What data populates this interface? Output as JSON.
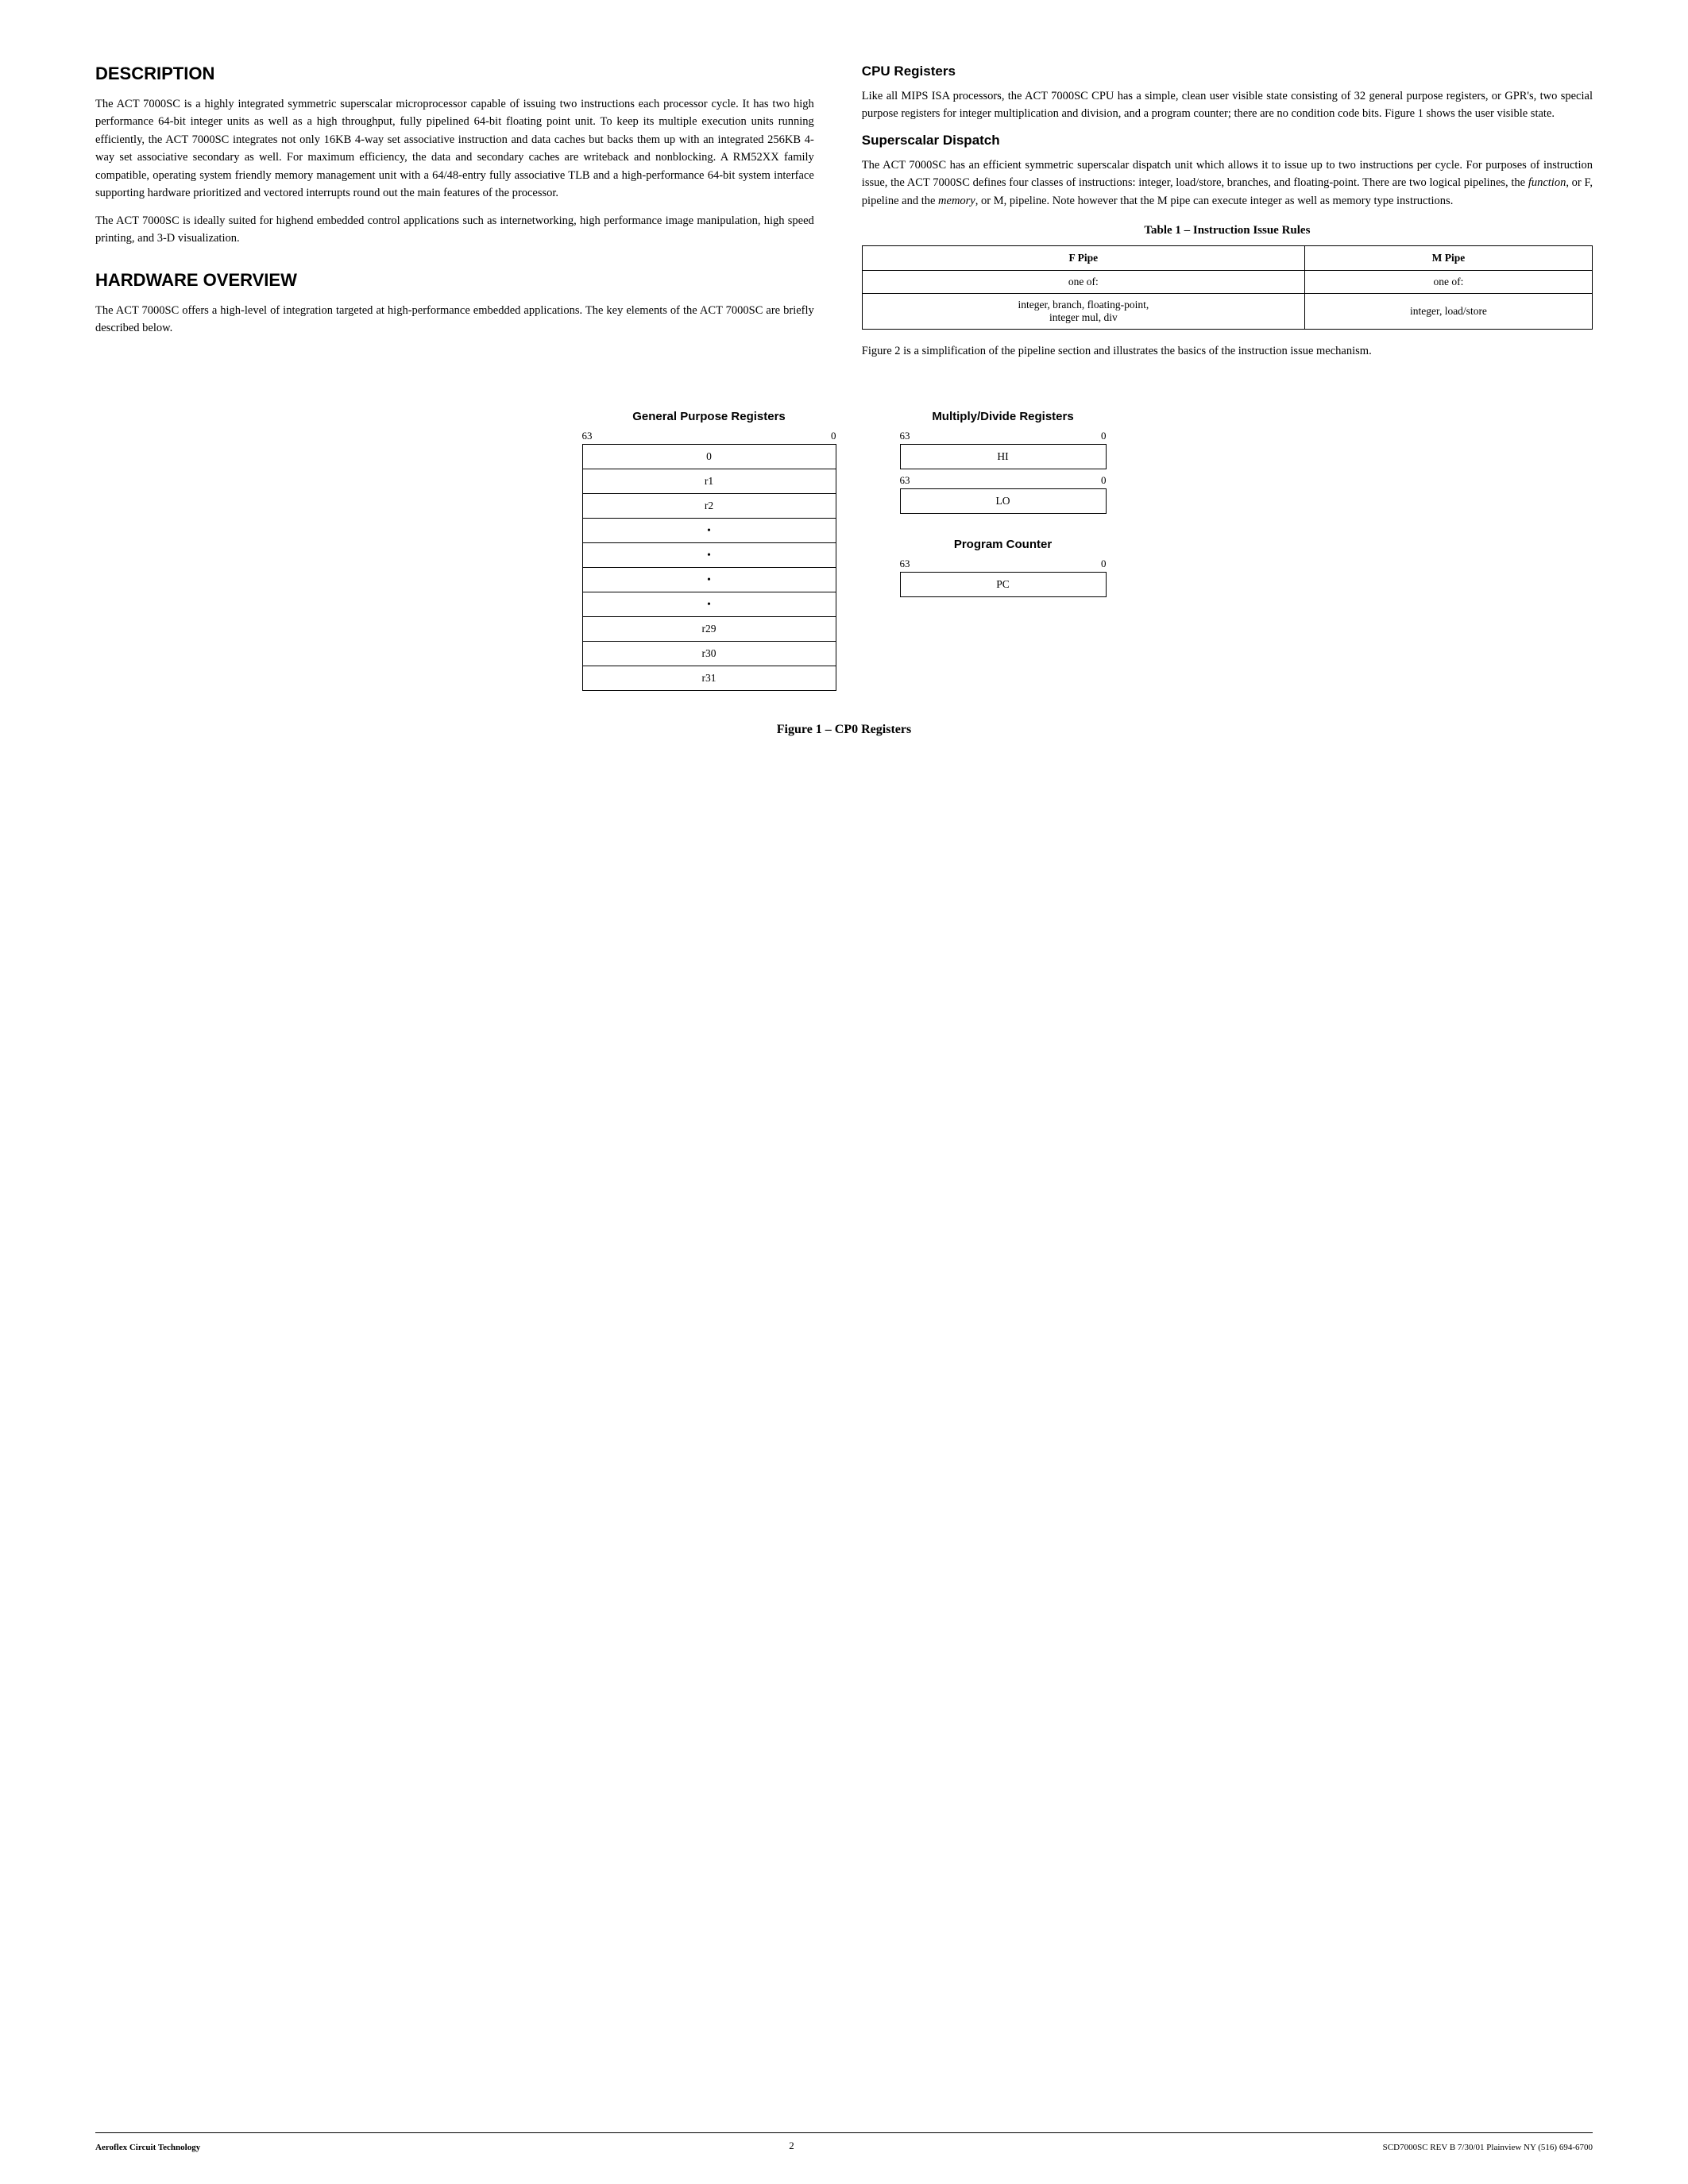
{
  "page": {
    "footer": {
      "left": "Aeroflex Circuit Technology",
      "center": "2",
      "right": "SCD7000SC REV B  7/30/01 Plainview NY (516) 694-6700"
    }
  },
  "description": {
    "title": "DESCRIPTION",
    "paragraphs": [
      "The ACT 7000SC is a highly integrated symmetric superscalar microprocessor capable of issuing two instructions each processor cycle. It has two high performance 64-bit integer units as well as a high throughput, fully pipelined 64-bit floating point unit. To keep its multiple execution units running efficiently, the ACT 7000SC integrates not only 16KB 4-way set associative instruction and data caches but backs them up with an integrated 256KB 4-way set associative secondary as well. For maximum efficiency, the data and secondary caches are writeback and nonblocking. A RM52XX family compatible, operating system friendly memory management unit with a 64/48-entry fully associative TLB and a high-performance 64-bit system interface supporting hardware prioritized and vectored interrupts round out the main features of the processor.",
      "The ACT 7000SC is ideally suited for highend embedded control applications such as internetworking, high performance image manipulation, high speed printing, and 3-D visualization."
    ]
  },
  "hardware_overview": {
    "title": "HARDWARE OVERVIEW",
    "paragraphs": [
      "The ACT 7000SC offers a high-level of integration targeted at high-performance embedded applications. The key elements of the ACT 7000SC are briefly described below."
    ]
  },
  "cpu_registers": {
    "title": "CPU Registers",
    "paragraphs": [
      "Like all MIPS ISA processors, the ACT 7000SC CPU has a simple, clean user visible state consisting of 32 general purpose registers, or GPR's, two special purpose registers for integer multiplication and division, and a program counter; there are no condition code bits. Figure 1 shows the user visible state."
    ]
  },
  "superscalar_dispatch": {
    "title": "Superscalar Dispatch",
    "paragraphs": [
      "The ACT 7000SC has an efficient symmetric superscalar dispatch unit which allows it to issue up to two instructions per cycle. For purposes of instruction issue, the ACT 7000SC defines four classes of instructions: integer, load/store, branches, and floating-point. There are two logical pipelines, the function, or F, pipeline and the memory, or M, pipeline. Note however that the M pipe can execute integer as well as memory type instructions."
    ]
  },
  "table1": {
    "caption": "Table 1 – Instruction Issue Rules",
    "headers": [
      "F Pipe",
      "M Pipe"
    ],
    "row1": [
      "one of:",
      "one of:"
    ],
    "row2": [
      "integer, branch, floating-point, integer mul, div",
      "integer, load/store"
    ]
  },
  "pipeline_note": {
    "text": "Figure 2 is a simplification of the pipeline section and illustrates the basics of the instruction issue mechanism."
  },
  "gpr": {
    "title": "General Purpose Registers",
    "range_start": "63",
    "range_end": "0",
    "rows": [
      "0",
      "r1",
      "r2",
      "•",
      "•",
      "•",
      "•",
      "r29",
      "r30",
      "r31"
    ]
  },
  "multiply_divide": {
    "title": "Multiply/Divide Registers",
    "hi_range_start": "63",
    "hi_range_end": "0",
    "hi_label": "HI",
    "lo_range_start": "63",
    "lo_range_end": "0",
    "lo_label": "LO"
  },
  "program_counter": {
    "title": "Program Counter",
    "range_start": "63",
    "range_end": "0",
    "label": "PC"
  },
  "figure_caption": "Figure 1 – CP0 Registers"
}
